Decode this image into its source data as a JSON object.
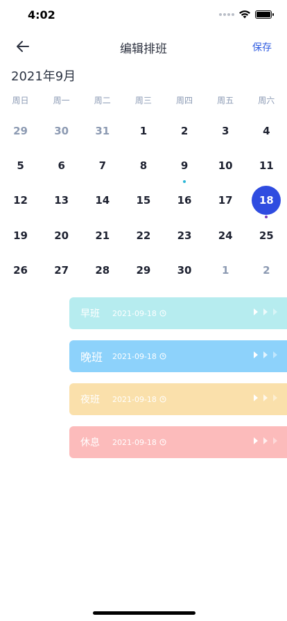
{
  "status_bar": {
    "time": "4:02"
  },
  "nav": {
    "title": "编辑排班",
    "save_label": "保存"
  },
  "calendar": {
    "month_title": "2021年9月",
    "weekdays": [
      "周日",
      "周一",
      "周二",
      "周三",
      "周四",
      "周五",
      "周六"
    ],
    "days": [
      {
        "num": "29",
        "muted": true
      },
      {
        "num": "30",
        "muted": true
      },
      {
        "num": "31",
        "muted": true
      },
      {
        "num": "1"
      },
      {
        "num": "2"
      },
      {
        "num": "3"
      },
      {
        "num": "4"
      },
      {
        "num": "5"
      },
      {
        "num": "6"
      },
      {
        "num": "7"
      },
      {
        "num": "8"
      },
      {
        "num": "9",
        "dot": "#29b6d6"
      },
      {
        "num": "10"
      },
      {
        "num": "11"
      },
      {
        "num": "12"
      },
      {
        "num": "13"
      },
      {
        "num": "14"
      },
      {
        "num": "15"
      },
      {
        "num": "16"
      },
      {
        "num": "17"
      },
      {
        "num": "18",
        "selected": true,
        "dot": "#7b3bb8"
      },
      {
        "num": "19"
      },
      {
        "num": "20"
      },
      {
        "num": "21"
      },
      {
        "num": "22"
      },
      {
        "num": "23"
      },
      {
        "num": "24"
      },
      {
        "num": "25"
      },
      {
        "num": "26"
      },
      {
        "num": "27"
      },
      {
        "num": "28"
      },
      {
        "num": "29"
      },
      {
        "num": "30"
      },
      {
        "num": "1",
        "muted": true
      },
      {
        "num": "2",
        "muted": true
      }
    ]
  },
  "shifts": [
    {
      "name": "早班",
      "date": "2021-09-18",
      "color": "#b6ecef",
      "big": false
    },
    {
      "name": "晚班",
      "date": "2021-09-18",
      "color": "#8dd2fb",
      "big": true
    },
    {
      "name": "夜班",
      "date": "2021-09-18",
      "color": "#fae0ab",
      "big": false
    },
    {
      "name": "休息",
      "date": "2021-09-18",
      "color": "#fcbbbb",
      "big": false
    }
  ]
}
